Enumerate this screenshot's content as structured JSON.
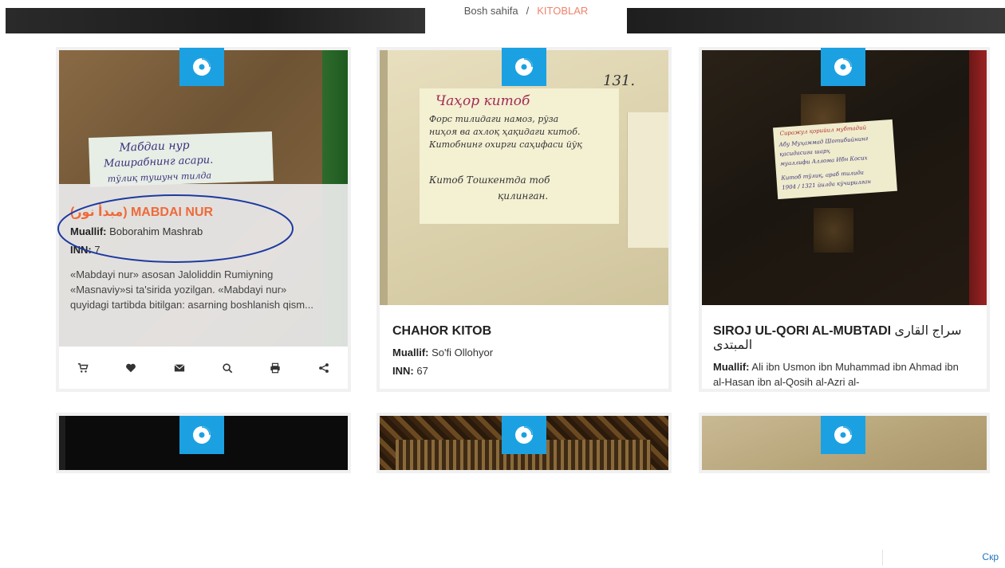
{
  "breadcrumb": {
    "home": "Bosh sahifa",
    "separator": "/",
    "current": "KITOBLAR"
  },
  "colors": {
    "accent": "#1ba1e2",
    "highlight": "#ee6a3a",
    "breadcrumb_current": "#f0826b"
  },
  "cards": [
    {
      "title_arabic": "(مبدأ نور)",
      "title": "MABDAI NUR",
      "author_label": "Muallif:",
      "author": "Boborahim Mashrab",
      "inn_label": "INN:",
      "inn": "7",
      "description": "«Mabdayi nur» asosan Jaloliddin Rumiyning «Masnaviy»si ta'sirida yozilgan. «Mabdayi nur» quyidagi tartibda bitilgan: asarning boshlanish qism...",
      "photo_note": [
        "Мабдаи нур",
        "Машрабнинг асари.",
        "тўлиқ тушунч тилда"
      ],
      "actions": [
        "cart-icon",
        "heart-icon",
        "envelope-icon",
        "search-icon",
        "print-icon",
        "share-icon"
      ]
    },
    {
      "title": "CHAHOR KITOB",
      "author_label": "Muallif:",
      "author": "So'fi Ollohyor",
      "inn_label": "INN:",
      "inn": "67",
      "photo_number": "131.",
      "photo_note": [
        "Чаҳор китоб",
        "Форс тилидаги намоз, рўза",
        "ниҳоя ва ахлоқ ҳақидаги китоб.",
        "Китобнинг охирги саҳифаси йўқ",
        "Китоб Тошкентда тоб",
        "қилинган."
      ]
    },
    {
      "title": "SIROJ UL-QORI AL-MUBTADI",
      "title_arabic": "سراج القاری المبتدی",
      "author_label": "Muallif:",
      "author": "Ali ibn Usmon ibn Muhammad ibn Ahmad ibn al-Hasan ibn al-Qosih al-Azri al-",
      "photo_note": [
        "Сиражул қорийил мубтадий",
        "Абу Муҳаммад Шотибийнинг",
        "қасидасига шарҳ",
        "муаллифи Аллома Ибн Косих",
        "Китоб тўлиқ, араб тилида",
        "1904 / 1321 йилда кўчирилган"
      ]
    }
  ],
  "corner": {
    "text": "Скр"
  }
}
